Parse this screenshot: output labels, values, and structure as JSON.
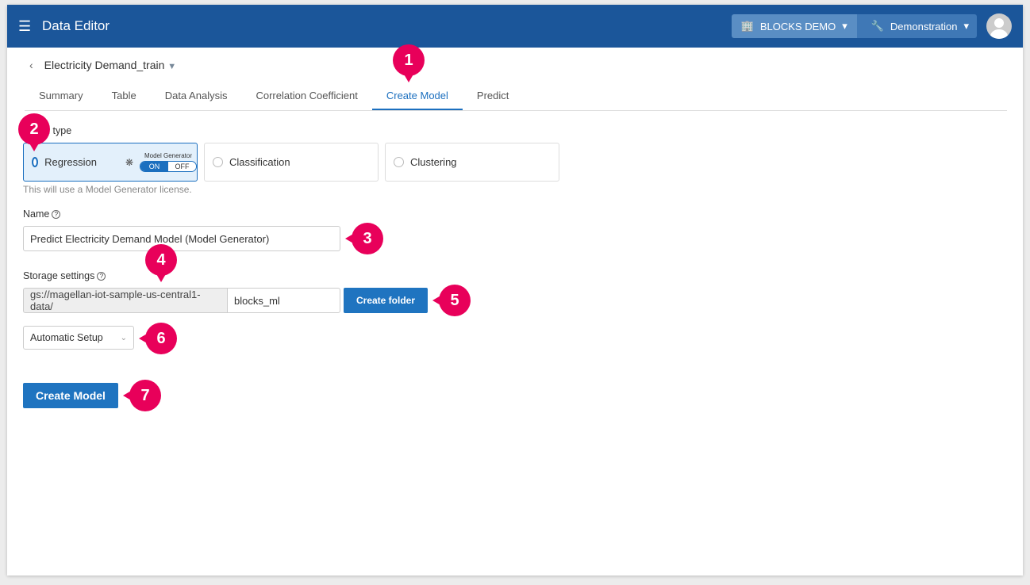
{
  "header": {
    "title": "Data Editor",
    "org": "BLOCKS DEMO",
    "project": "Demonstration"
  },
  "dataset": {
    "name": "Electricity Demand_train"
  },
  "tabs": [
    "Summary",
    "Table",
    "Data Analysis",
    "Correlation Coefficient",
    "Create Model",
    "Predict"
  ],
  "active_tab": "Create Model",
  "model_type": {
    "label": "Model type",
    "options": [
      "Regression",
      "Classification",
      "Clustering"
    ],
    "selected": "Regression",
    "generator_label": "Model Generator",
    "toggle_on": "ON",
    "toggle_off": "OFF",
    "toggle_state": "ON",
    "note": "This will use a Model Generator license."
  },
  "name": {
    "label": "Name",
    "value": "Predict Electricity Demand Model (Model Generator)"
  },
  "storage": {
    "label": "Storage settings",
    "prefix": "gs://magellan-iot-sample-us-central1-data/",
    "folder": "blocks_ml",
    "create_folder": "Create folder"
  },
  "setup": {
    "value": "Automatic Setup"
  },
  "create_model": "Create Model",
  "badges": [
    "1",
    "2",
    "3",
    "4",
    "5",
    "6",
    "7"
  ]
}
